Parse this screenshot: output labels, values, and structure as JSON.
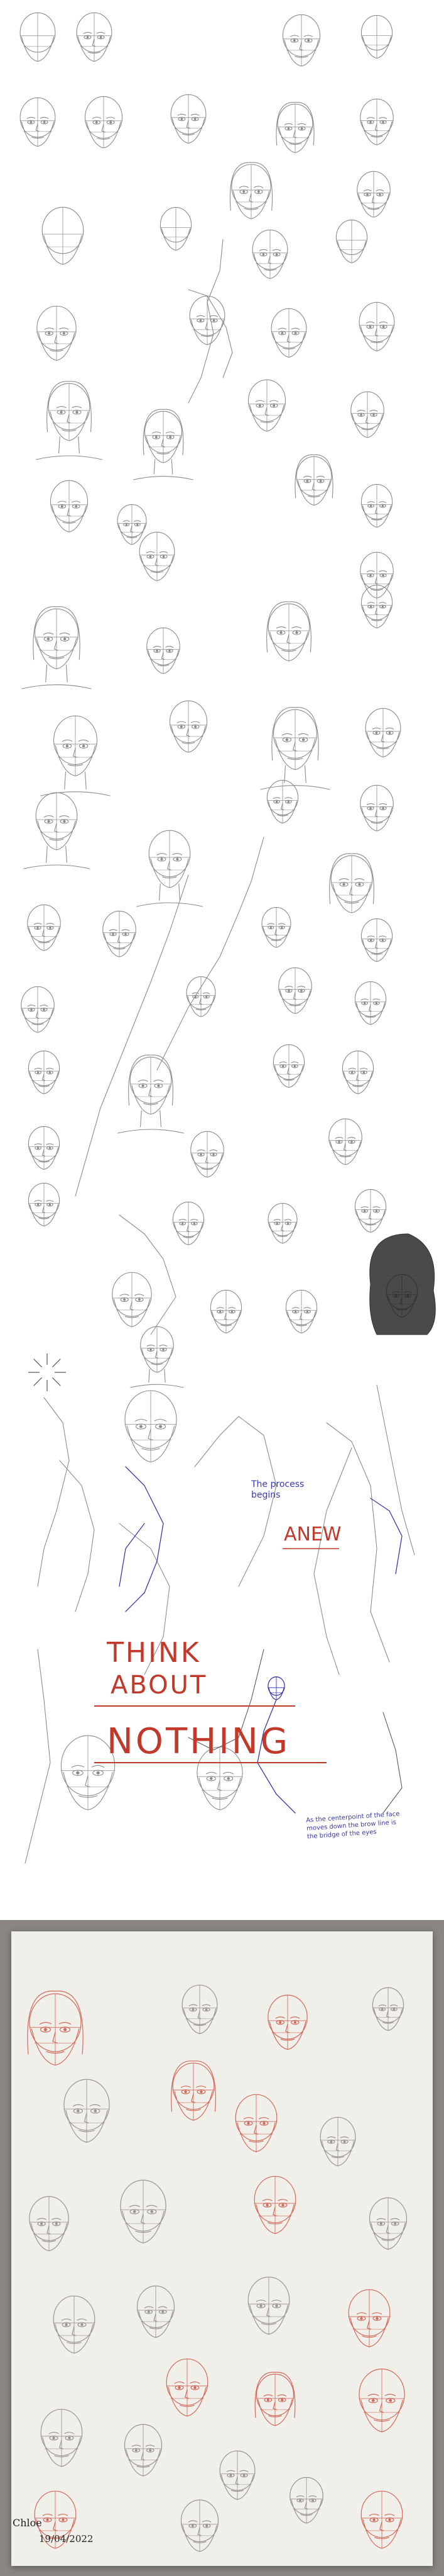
{
  "sheet": {
    "think_label": "THINK",
    "about_label": "ABOUT",
    "nothing_label": "NOTHING",
    "process_label": "The process begins",
    "anew_label": "ANEW",
    "note_label": "As the centerpoint of the face moves down the brow line is the bridge of the eyes",
    "signature_name": "Chloe",
    "signature_date": "19/04/2022"
  },
  "colors": {
    "pencil": "#8c8c8c",
    "pencil_dark": "#5a5a5a",
    "accent_red": "#c0392b",
    "accent_blue": "#3b3bb0",
    "photo_red": "#d06a5c",
    "paper": "#f1efe9",
    "background_photo": "#8a8782"
  }
}
